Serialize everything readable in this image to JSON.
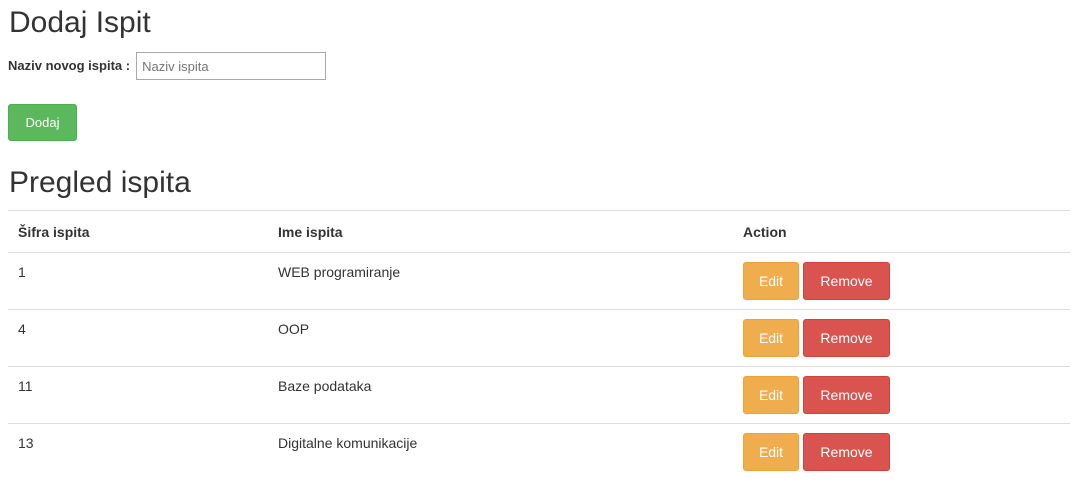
{
  "add_section": {
    "title": "Dodaj Ispit",
    "field_label": "Naziv novog ispita :",
    "field_placeholder": "Naziv ispita",
    "field_value": "",
    "submit_label": "Dodaj"
  },
  "overview_section": {
    "title": "Pregled ispita",
    "columns": [
      "Šifra ispita",
      "Ime ispita",
      "Action"
    ],
    "rows": [
      {
        "id": "1",
        "name": "WEB programiranje"
      },
      {
        "id": "4",
        "name": "OOP"
      },
      {
        "id": "11",
        "name": "Baze podataka"
      },
      {
        "id": "13",
        "name": "Digitalne komunikacije"
      }
    ],
    "edit_label": "Edit",
    "remove_label": "Remove"
  },
  "colors": {
    "success": "#5cb85c",
    "warning": "#f0ad4e",
    "danger": "#d9534f"
  }
}
